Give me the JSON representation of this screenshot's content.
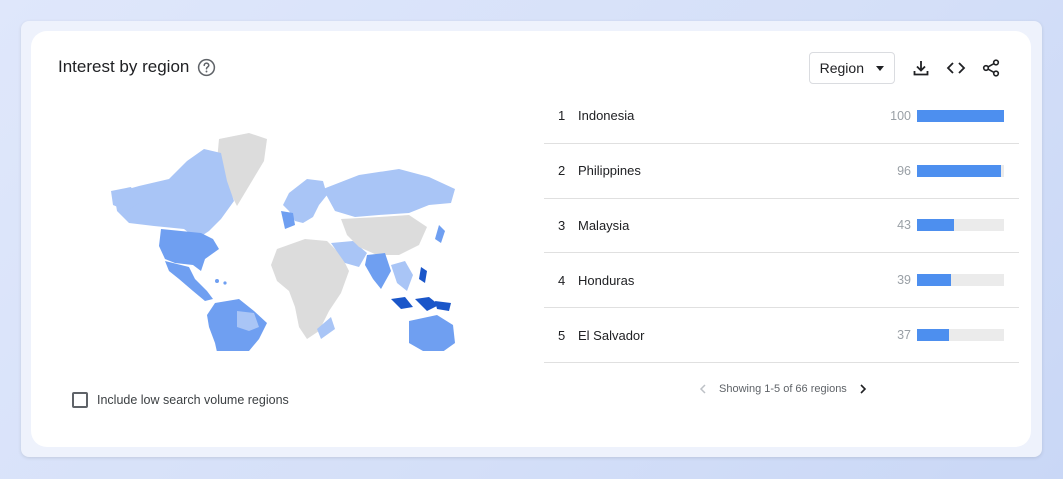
{
  "widget": {
    "title": "Interest by region",
    "region_select": "Region"
  },
  "colors": {
    "bar": "#4d8fef",
    "map_high": "#1a56c9",
    "map_mid": "#6f9ff1",
    "map_low": "#a9c5f6",
    "map_none": "#dcdcdc"
  },
  "icons": [
    "help-icon",
    "download-icon",
    "embed-icon",
    "share-icon",
    "chevron-left-icon",
    "chevron-right-icon"
  ],
  "regions": [
    {
      "rank": "1",
      "name": "Indonesia",
      "value": 100
    },
    {
      "rank": "2",
      "name": "Philippines",
      "value": 96
    },
    {
      "rank": "3",
      "name": "Malaysia",
      "value": 43
    },
    {
      "rank": "4",
      "name": "Honduras",
      "value": 39
    },
    {
      "rank": "5",
      "name": "El Salvador",
      "value": 37
    }
  ],
  "checkbox": {
    "label": "Include low search volume regions",
    "checked": false
  },
  "pager": {
    "text": "Showing 1-5 of 66 regions"
  }
}
